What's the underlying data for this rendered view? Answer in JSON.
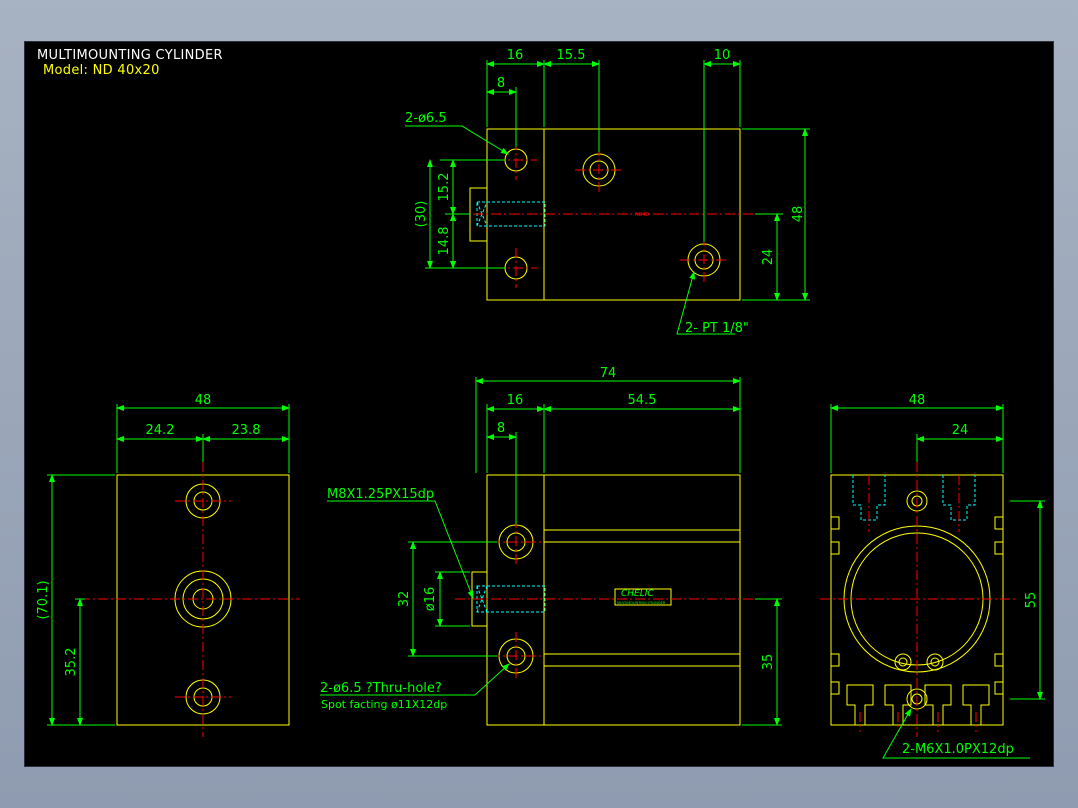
{
  "header": {
    "title": "MULTIMOUNTING CYLINDER",
    "model": "Model: ND 40x20"
  },
  "colors": {
    "background": "#000000",
    "outline": "#ffff00",
    "dimension": "#00ff00",
    "centerline": "#ff0000",
    "hidden": "#00ffff",
    "text": "#ffffff"
  },
  "top_view": {
    "dims": {
      "d16": "16",
      "d15_5": "15.5",
      "d10": "10",
      "d8": "8",
      "d15_2": "15.2",
      "d30": "(30)",
      "d14_8": "14.8",
      "d48": "48",
      "d24": "24"
    },
    "hole_callout": "2-ø6.5",
    "port_callout": "2- PT 1/8\"",
    "mark": "ND40"
  },
  "left_view": {
    "dims": {
      "d48": "48",
      "d24_2": "24.2",
      "d23_8": "23.8",
      "d70_1": "(70.1)",
      "d35_2": "35.2"
    }
  },
  "front_view": {
    "dims": {
      "d74": "74",
      "d16": "16",
      "d54_5": "54.5",
      "d8": "8",
      "d32": "32",
      "d16dia": "ø16",
      "d35": "35"
    },
    "thread_callout": "M8X1.25PX15dp",
    "hole_callout": "2-ø6.5 ?Thru-hole?",
    "spot_callout": "Spot facting  ø11X12dp",
    "label_brand": "CHELIC",
    "label_line": "MULTIMOUNTING CYLINDER"
  },
  "right_view": {
    "dims": {
      "d48": "48",
      "d24": "24",
      "d55": "55"
    },
    "thread_callout": "2-M6X1.0PX12dp"
  }
}
